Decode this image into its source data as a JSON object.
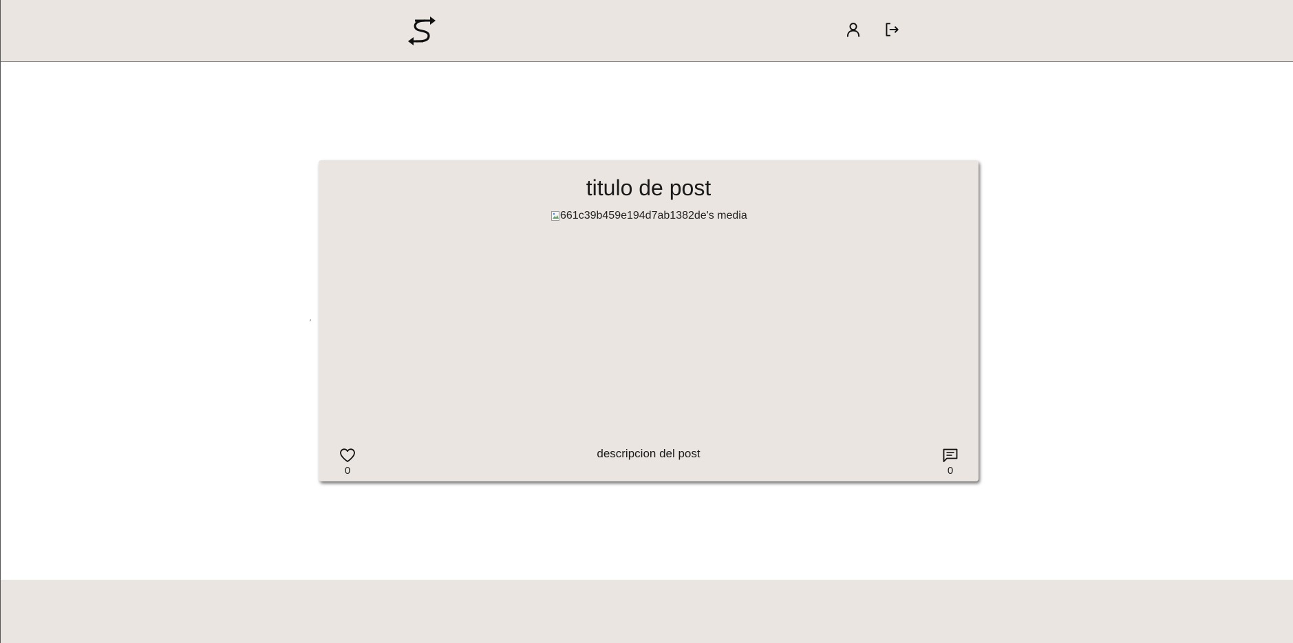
{
  "header": {
    "logo_icon": "swap-s-logo-icon",
    "nav": {
      "profile_icon": "user-icon",
      "logout_icon": "logout-icon"
    }
  },
  "post": {
    "title": "titulo de post",
    "media_alt": "661c39b459e194d7ab1382de's media",
    "description": "descripcion del post",
    "likes": "0",
    "comments": "0"
  },
  "colors": {
    "header_bg": "#eae5e0",
    "card_bg": "#eae5e0",
    "footer_bg": "#eae5e0",
    "page_bg": "#ffffff"
  }
}
